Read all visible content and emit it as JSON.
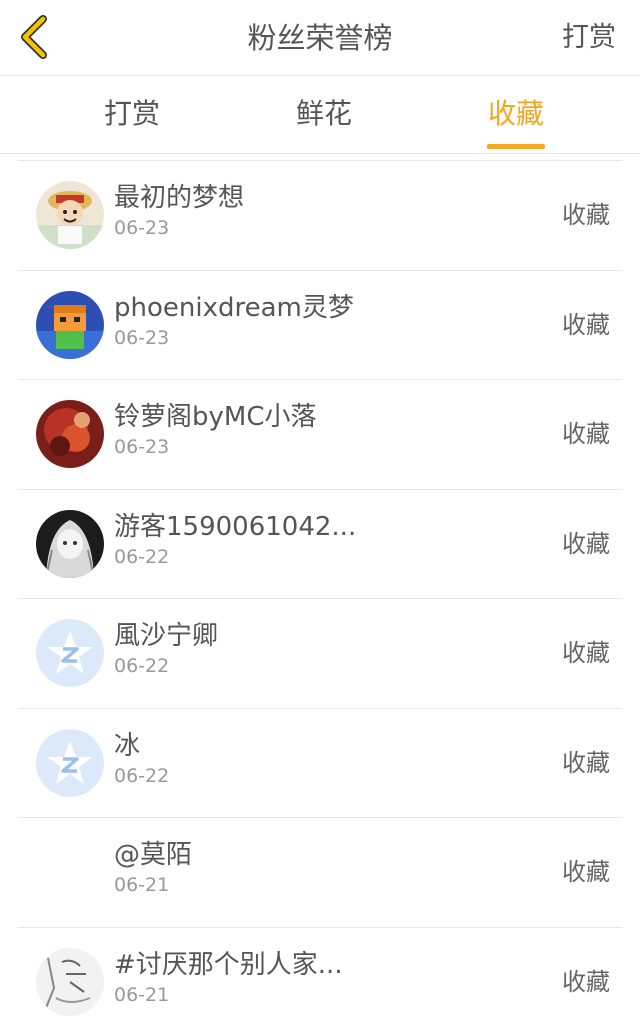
{
  "header": {
    "title": "粉丝荣誉榜",
    "action_label": "打赏"
  },
  "tabs": [
    {
      "label": "打赏",
      "active": false
    },
    {
      "label": "鲜花",
      "active": false
    },
    {
      "label": "收藏",
      "active": true
    }
  ],
  "colors": {
    "accent": "#f5a623",
    "back_icon": "#e6b800",
    "divider": "#e8e8e8"
  },
  "list": [
    {
      "name": "最初的梦想",
      "date": "06-23",
      "action": "收藏",
      "avatar": "cartoon-boy-avatar"
    },
    {
      "name": "phoenixdream灵梦",
      "date": "06-23",
      "action": "收藏",
      "avatar": "blocky-character-avatar"
    },
    {
      "name": "铃萝阁byMC小落",
      "date": "06-23",
      "action": "收藏",
      "avatar": "red-abstract-avatar"
    },
    {
      "name": "游客1590061042...",
      "date": "06-22",
      "action": "收藏",
      "avatar": "anime-girl-avatar"
    },
    {
      "name": "風沙宁卿",
      "date": "06-22",
      "action": "收藏",
      "avatar": "default-star-avatar"
    },
    {
      "name": "冰",
      "date": "06-22",
      "action": "收藏",
      "avatar": "default-star-avatar"
    },
    {
      "name": "@莫陌",
      "date": "06-21",
      "action": "收藏",
      "avatar": "blank-avatar"
    },
    {
      "name": "#讨厌那个别人家...",
      "date": "06-21",
      "action": "收藏",
      "avatar": "sketch-avatar"
    }
  ]
}
